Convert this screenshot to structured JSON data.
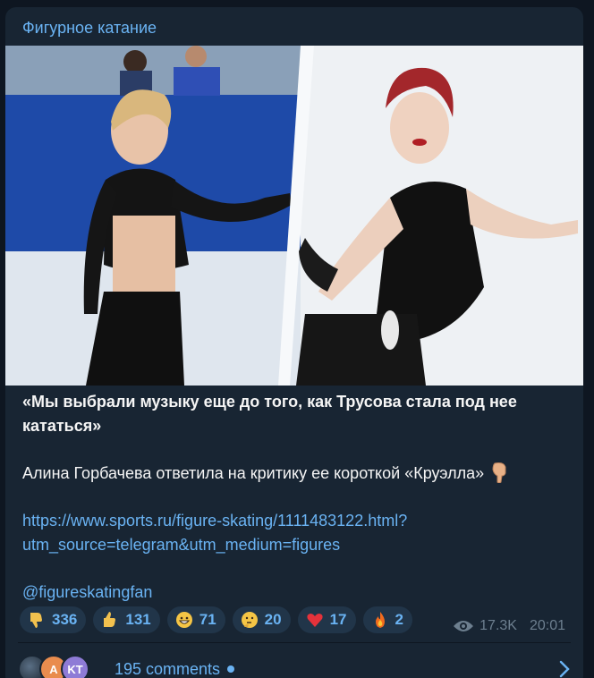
{
  "channel": {
    "name": "Фигурное катание"
  },
  "post": {
    "headline": "«Мы выбрали музыку еще до того, как Трусова стала под нее кататься»",
    "body": "Алина Горбачева ответила на критику ее короткой «Круэлла»",
    "link_line1": "https://www.sports.ru/figure-skating/1111483122.html?",
    "link_line2": "utm_source=telegram&utm_medium=figures",
    "mention": "@figureskatingfan",
    "emoji_icon": "backhand-index-pointing-down-icon"
  },
  "reactions": [
    {
      "icon": "thumbs-down-icon",
      "count": "336"
    },
    {
      "icon": "thumbs-up-icon",
      "count": "131"
    },
    {
      "icon": "grinning-face-icon",
      "count": "71"
    },
    {
      "icon": "thinking-face-icon",
      "count": "20"
    },
    {
      "icon": "red-heart-icon",
      "count": "17"
    },
    {
      "icon": "fire-icon",
      "count": "2"
    }
  ],
  "meta": {
    "views": "17.3K",
    "time": "20:01"
  },
  "comments": {
    "label": "195 comments",
    "avatars": [
      "",
      "A",
      "KT"
    ]
  },
  "colors": {
    "background": "#0e1621",
    "card": "#182533",
    "accent": "#6ab3f3",
    "muted": "#6d7f8f"
  }
}
